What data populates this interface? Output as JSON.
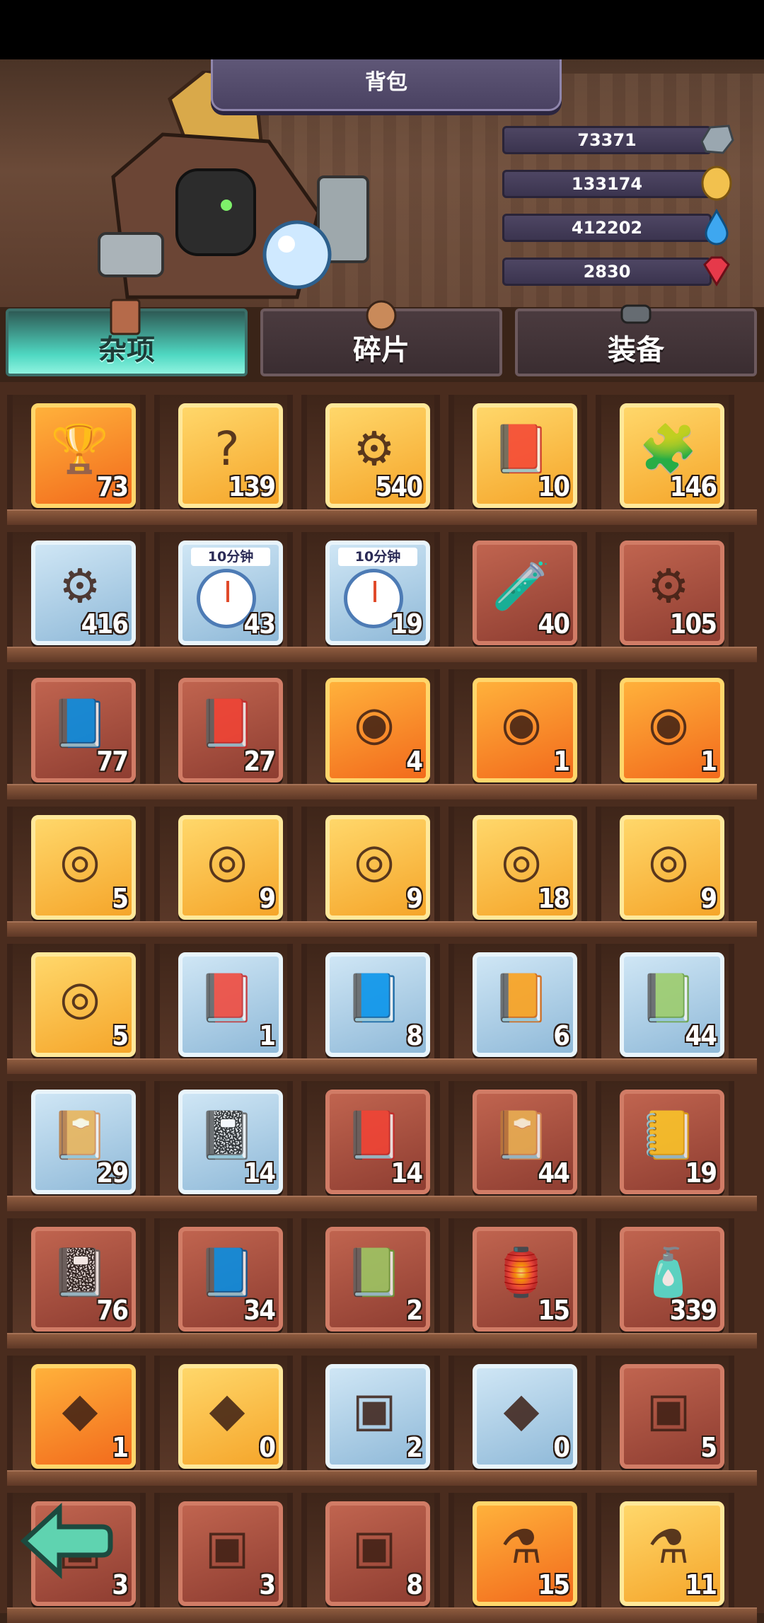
{
  "window": {
    "title": "背包"
  },
  "resources": [
    {
      "name": "stone",
      "value": "73371",
      "icon": "stone-icon",
      "color": "#9aa7b0"
    },
    {
      "name": "coin",
      "value": "133174",
      "icon": "gold-coin-icon",
      "color": "#f2c14e"
    },
    {
      "name": "water",
      "value": "412202",
      "icon": "water-drop-icon",
      "color": "#3ea7f0"
    },
    {
      "name": "gem",
      "value": "2830",
      "icon": "ruby-gem-icon",
      "color": "#e6394a"
    }
  ],
  "tabs": [
    {
      "label": "杂项",
      "active": true,
      "icon": "book-scroll-icon"
    },
    {
      "label": "碎片",
      "active": false,
      "icon": "hero-fragment-icon"
    },
    {
      "label": "装备",
      "active": false,
      "icon": "cannon-icon"
    }
  ],
  "items": [
    [
      {
        "name": "goblet-icon",
        "glyph": "🏆",
        "count": "73",
        "frame": "orange"
      },
      {
        "name": "mystery-stone-icon",
        "glyph": "?",
        "count": "139",
        "frame": "gold"
      },
      {
        "name": "blue-gear-icon",
        "glyph": "⚙",
        "count": "540",
        "frame": "gold"
      },
      {
        "name": "purple-book-icon",
        "glyph": "📕",
        "count": "10",
        "frame": "gold"
      },
      {
        "name": "puzzle-piece-icon",
        "glyph": "🧩",
        "count": "146",
        "frame": "gold"
      }
    ],
    [
      {
        "name": "gold-gear-medal-icon",
        "glyph": "⚙",
        "count": "416",
        "frame": "blue"
      },
      {
        "name": "clock-potion-icon",
        "glyph": "",
        "count": "43",
        "frame": "blue",
        "tag": "10分钟"
      },
      {
        "name": "clock-gear-icon",
        "glyph": "",
        "count": "19",
        "frame": "blue",
        "tag": "10分钟"
      },
      {
        "name": "potion-bottle-icon",
        "glyph": "🧪",
        "count": "40",
        "frame": "brown"
      },
      {
        "name": "grey-gear-medal-icon",
        "glyph": "⚙",
        "count": "105",
        "frame": "brown"
      }
    ],
    [
      {
        "name": "purple-spellbook-icon",
        "glyph": "📘",
        "count": "77",
        "frame": "brown"
      },
      {
        "name": "red-gear-book-icon",
        "glyph": "📕",
        "count": "27",
        "frame": "brown"
      },
      {
        "name": "eye-medal-icon",
        "glyph": "◉",
        "count": "4",
        "frame": "orange"
      },
      {
        "name": "eye-medal-icon",
        "glyph": "◉",
        "count": "1",
        "frame": "orange"
      },
      {
        "name": "eye-medal-icon",
        "glyph": "◉",
        "count": "1",
        "frame": "orange"
      }
    ],
    [
      {
        "name": "eye-amulet-icon",
        "glyph": "◎",
        "count": "5",
        "frame": "gold"
      },
      {
        "name": "eye-amulet-icon",
        "glyph": "◎",
        "count": "9",
        "frame": "gold"
      },
      {
        "name": "eye-amulet-icon",
        "glyph": "◎",
        "count": "9",
        "frame": "gold"
      },
      {
        "name": "eye-amulet-icon",
        "glyph": "◎",
        "count": "18",
        "frame": "gold"
      },
      {
        "name": "eye-amulet-icon",
        "glyph": "◎",
        "count": "9",
        "frame": "gold"
      }
    ],
    [
      {
        "name": "eye-amulet-icon",
        "glyph": "◎",
        "count": "5",
        "frame": "gold"
      },
      {
        "name": "red-tome-icon",
        "glyph": "📕",
        "count": "1",
        "frame": "blue"
      },
      {
        "name": "blue-tome-icon",
        "glyph": "📘",
        "count": "8",
        "frame": "blue"
      },
      {
        "name": "brown-tome-icon",
        "glyph": "📙",
        "count": "6",
        "frame": "blue"
      },
      {
        "name": "green-tome-icon",
        "glyph": "📗",
        "count": "44",
        "frame": "blue"
      }
    ],
    [
      {
        "name": "purple-tome-icon",
        "glyph": "📔",
        "count": "29",
        "frame": "blue"
      },
      {
        "name": "grey-tome-icon",
        "glyph": "📓",
        "count": "14",
        "frame": "blue"
      },
      {
        "name": "red-scroll-book-icon",
        "glyph": "📕",
        "count": "14",
        "frame": "brown"
      },
      {
        "name": "purple-scroll-book-icon",
        "glyph": "📔",
        "count": "44",
        "frame": "brown"
      },
      {
        "name": "yellow-scroll-book-icon",
        "glyph": "📒",
        "count": "19",
        "frame": "brown"
      }
    ],
    [
      {
        "name": "grey-scroll-book-icon",
        "glyph": "📓",
        "count": "76",
        "frame": "brown"
      },
      {
        "name": "blue-scroll-book-icon",
        "glyph": "📘",
        "count": "34",
        "frame": "brown"
      },
      {
        "name": "green-scroll-book-icon",
        "glyph": "📗",
        "count": "2",
        "frame": "brown"
      },
      {
        "name": "lantern-icon",
        "glyph": "🏮",
        "count": "15",
        "frame": "brown"
      },
      {
        "name": "bottle-brush-icon",
        "glyph": "🧴",
        "count": "339",
        "frame": "brown"
      }
    ],
    [
      {
        "name": "rainbow-shard-icon",
        "glyph": "◆",
        "count": "1",
        "frame": "orange"
      },
      {
        "name": "gold-shard-icon",
        "glyph": "◆",
        "count": "0",
        "frame": "gold"
      },
      {
        "name": "portrait-card-icon",
        "glyph": "▣",
        "count": "2",
        "frame": "blue"
      },
      {
        "name": "white-shard-icon",
        "glyph": "◆",
        "count": "0",
        "frame": "blue"
      },
      {
        "name": "rifle-card-icon",
        "glyph": "▣",
        "count": "5",
        "frame": "brown"
      }
    ],
    [
      {
        "name": "card-icon",
        "glyph": "▣",
        "count": "3",
        "frame": "brown"
      },
      {
        "name": "card-icon",
        "glyph": "▣",
        "count": "3",
        "frame": "brown"
      },
      {
        "name": "card-icon",
        "glyph": "▣",
        "count": "8",
        "frame": "brown"
      },
      {
        "name": "potion-flask-icon",
        "glyph": "⚗",
        "count": "15",
        "frame": "orange"
      },
      {
        "name": "potion-flask-icon",
        "glyph": "⚗",
        "count": "11",
        "frame": "gold"
      }
    ]
  ],
  "back_button": {
    "icon": "back-arrow-icon"
  }
}
